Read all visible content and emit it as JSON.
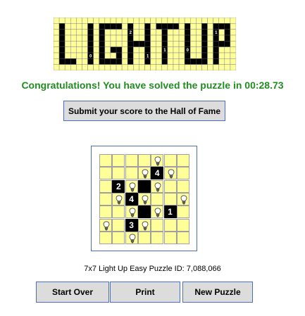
{
  "logo_alt": "LIGHT UP",
  "message": "Congratulations! You have solved the puzzle in 00:28.73",
  "submit_label": "Submit your score to the Hall of Fame",
  "puzzle_info": "7x7 Light Up Easy Puzzle ID: 7,088,066",
  "buttons": {
    "start_over": "Start Over",
    "print": "Print",
    "new_puzzle": "New Puzzle"
  },
  "colors": {
    "cell": "#ffff99",
    "wall": "#000000",
    "accent_green": "#228b22",
    "frame": "#4a6fb5"
  },
  "board": {
    "size": 7,
    "rows": [
      [
        ".",
        ".",
        ".",
        ".",
        "B",
        ".",
        "."
      ],
      [
        ".",
        ".",
        ".",
        "B",
        "4",
        "B",
        "."
      ],
      [
        ".",
        "2",
        "B",
        "#",
        "B",
        ".",
        "."
      ],
      [
        ".",
        "B",
        "4",
        "B",
        ".",
        ".",
        "B"
      ],
      [
        ".",
        ".",
        "B",
        "#",
        "B",
        "1",
        "."
      ],
      [
        "B",
        ".",
        "3",
        "B",
        ".",
        ".",
        "."
      ],
      [
        ".",
        ".",
        "B",
        ".",
        ".",
        ".",
        "."
      ]
    ]
  }
}
